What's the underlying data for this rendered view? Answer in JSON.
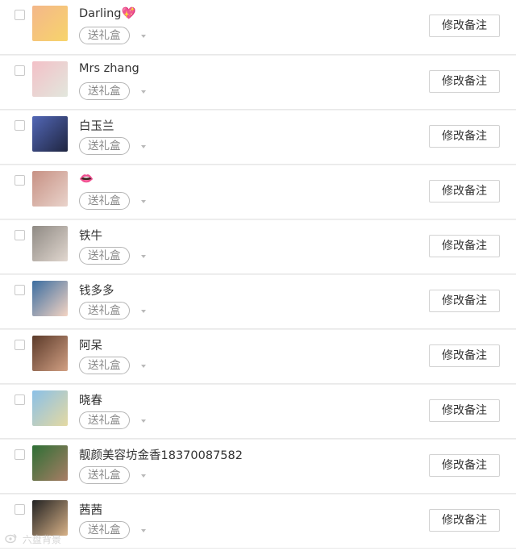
{
  "contacts": [
    {
      "name": "Darling💖",
      "gift_label": "送礼盒",
      "remark_button": "修改备注",
      "avatar_colors": [
        "#f4b78a",
        "#f7d46b"
      ]
    },
    {
      "name": "Mrs zhang",
      "gift_label": "送礼盒",
      "remark_button": "修改备注",
      "avatar_colors": [
        "#f3c0c7",
        "#e2e7dd"
      ]
    },
    {
      "name": "白玉兰",
      "gift_label": "送礼盒",
      "remark_button": "修改备注",
      "avatar_colors": [
        "#5267b6",
        "#1f2540"
      ]
    },
    {
      "name": "👄",
      "gift_label": "送礼盒",
      "remark_button": "修改备注",
      "avatar_colors": [
        "#c79184",
        "#e9d3cb"
      ]
    },
    {
      "name": "铁牛",
      "gift_label": "送礼盒",
      "remark_button": "修改备注",
      "avatar_colors": [
        "#8f8a84",
        "#e1d7cf"
      ]
    },
    {
      "name": "钱多多",
      "gift_label": "送礼盒",
      "remark_button": "修改备注",
      "avatar_colors": [
        "#3b6da0",
        "#f4d4c3"
      ]
    },
    {
      "name": "阿呆",
      "gift_label": "送礼盒",
      "remark_button": "修改备注",
      "avatar_colors": [
        "#5b3a2a",
        "#d2a083"
      ]
    },
    {
      "name": "晓春",
      "gift_label": "送礼盒",
      "remark_button": "修改备注",
      "avatar_colors": [
        "#8bc0e7",
        "#e4d9a2"
      ]
    },
    {
      "name": "靓颜美容坊金香18370087582",
      "gift_label": "送礼盒",
      "remark_button": "修改备注",
      "avatar_colors": [
        "#2e6f35",
        "#a87d65"
      ]
    },
    {
      "name": "茜茜",
      "gift_label": "送礼盒",
      "remark_button": "修改备注",
      "avatar_colors": [
        "#222222",
        "#d7b187"
      ]
    }
  ],
  "watermark": {
    "text": "六盘背景"
  }
}
